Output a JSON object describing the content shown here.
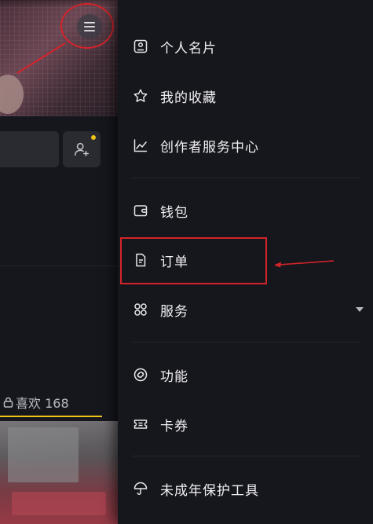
{
  "left_panel": {
    "likes_tab_label": "喜欢 168"
  },
  "drawer": {
    "items": [
      {
        "label": "个人名片",
        "icon": "profile-card-icon"
      },
      {
        "label": "我的收藏",
        "icon": "star-icon"
      },
      {
        "label": "创作者服务中心",
        "icon": "trend-chart-icon"
      },
      {
        "label": "钱包",
        "icon": "wallet-icon"
      },
      {
        "label": "订单",
        "icon": "order-document-icon"
      },
      {
        "label": "服务",
        "icon": "services-grid-icon"
      },
      {
        "label": "功能",
        "icon": "link-icon"
      },
      {
        "label": "卡券",
        "icon": "coupon-icon"
      },
      {
        "label": "未成年保护工具",
        "icon": "umbrella-icon"
      }
    ]
  },
  "colors": {
    "background": "#16171d",
    "accent_yellow": "#f0c419",
    "annotation_red": "#d5232a"
  }
}
